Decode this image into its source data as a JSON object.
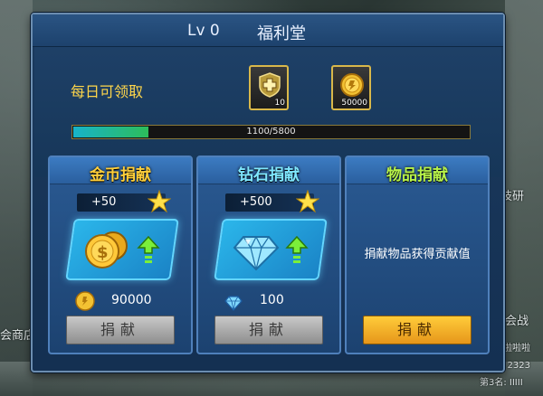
{
  "header": {
    "level": "Lv 0",
    "title": "福利堂"
  },
  "daily": {
    "label": "每日可领取",
    "rewards": [
      {
        "icon": "medal-icon",
        "qty": "10"
      },
      {
        "icon": "gold-coin-icon",
        "qty": "50000"
      }
    ],
    "progress": {
      "current": 1100,
      "max": 5800,
      "text": "1100/5800"
    }
  },
  "cards": [
    {
      "title": "金币捐献",
      "title_color": "gold",
      "bonus": "+50",
      "cost_icon": "gold-coin-icon",
      "cost": "90000",
      "button": "捐献",
      "button_state": "disabled"
    },
    {
      "title": "钻石捐献",
      "title_color": "cyan",
      "bonus": "+500",
      "cost_icon": "diamond-icon",
      "cost": "100",
      "button": "捐献",
      "button_state": "disabled"
    },
    {
      "title": "物品捐献",
      "title_color": "green",
      "note": "捐献物品获得贡献值",
      "button": "捐献",
      "button_state": "active"
    }
  ],
  "background": {
    "texts": [
      "竞技研",
      "会商店",
      "会战",
      "啦啦啦啦",
      "名: 2323",
      "第3名: IIIII"
    ]
  },
  "colors": {
    "panel": "#1b3a5e",
    "card": "#2a5a93",
    "accent_gold": "#ffcf3a",
    "button_active": "#f0a020",
    "button_disabled": "#a8a8a8"
  }
}
